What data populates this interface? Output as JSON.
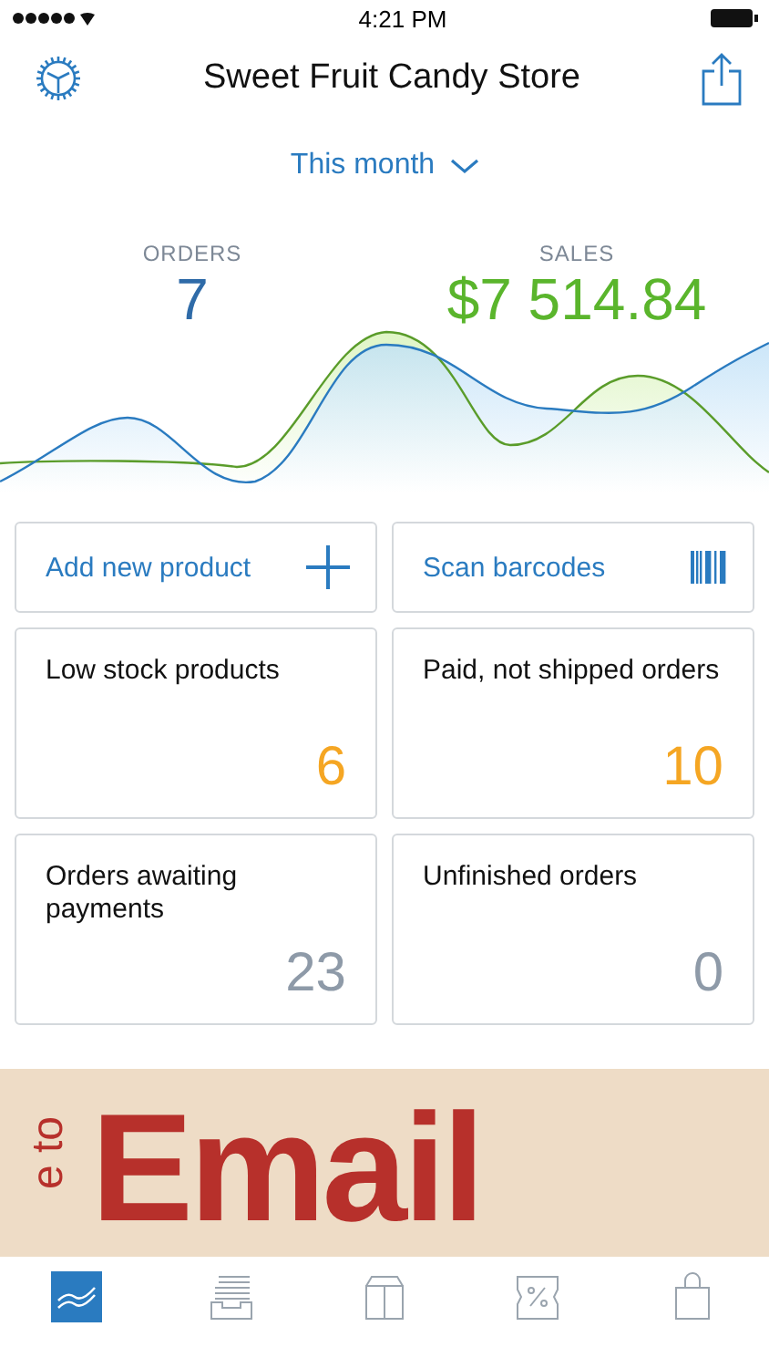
{
  "status_bar": {
    "time": "4:21 PM"
  },
  "nav": {
    "title": "Sweet Fruit Candy Store"
  },
  "period": {
    "label": "This month"
  },
  "stats": [
    {
      "label": "ORDERS",
      "value": "7",
      "kind": "orders"
    },
    {
      "label": "SALES",
      "value": "$7 514.84",
      "kind": "sales"
    }
  ],
  "actions": [
    {
      "label": "Add new product",
      "kind": "add"
    },
    {
      "label": "Scan barcodes",
      "kind": "scan"
    }
  ],
  "cards": [
    {
      "label": "Low stock products",
      "count": "6",
      "kind": "warning"
    },
    {
      "label": "Paid, not shipped orders",
      "count": "10",
      "kind": "warning"
    },
    {
      "label": "Orders awaiting payments",
      "count": "23",
      "kind": "neutral"
    },
    {
      "label": "Unfinished orders",
      "count": "0",
      "kind": "neutral"
    }
  ],
  "banner": {
    "side_text": "e to",
    "headline": "Email"
  },
  "tabs": [
    {
      "kind": "dashboard",
      "selected": true
    },
    {
      "kind": "orders",
      "selected": false
    },
    {
      "kind": "products",
      "selected": false
    },
    {
      "kind": "discounts",
      "selected": false
    },
    {
      "kind": "store",
      "selected": false
    }
  ]
}
